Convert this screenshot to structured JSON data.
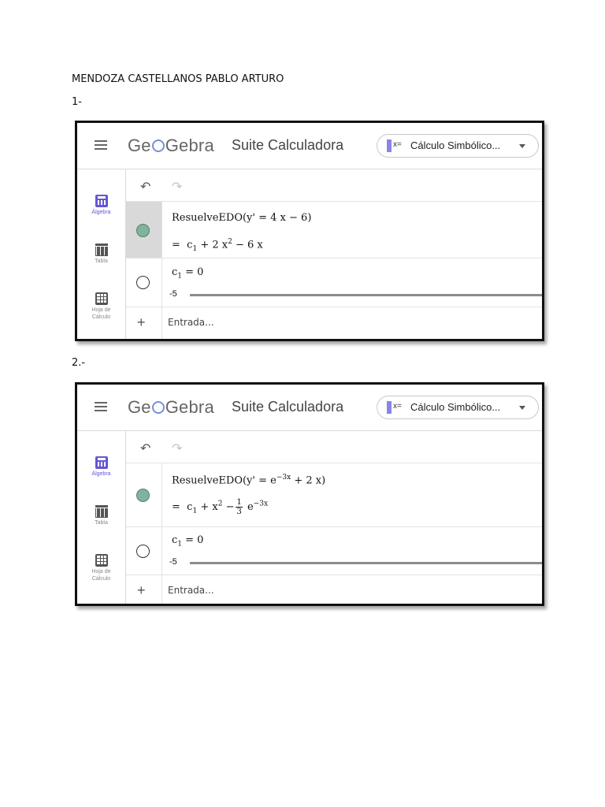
{
  "document": {
    "author": "MENDOZA CASTELLANOS PABLO ARTURO",
    "label_1": "1-",
    "label_2": "2.-"
  },
  "app": {
    "logo_part1": "Ge",
    "logo_part2": "Gebra",
    "suite_title": "Suite Calculadora",
    "selector_badge": "x=",
    "selector_value": "Cálculo Simbólico...",
    "sidebar": {
      "algebra": "Álgebra",
      "table": "Tabla",
      "sheet_line1": "Hoja de",
      "sheet_line2": "Cálculo"
    },
    "input_placeholder": "Entrada..."
  },
  "screens": [
    {
      "command_name": "ResuelveEDO",
      "command_args_prefix": "(y'",
      "command_eq": "= 4 x − 6)",
      "result_eq": "=",
      "result_a": "c",
      "result_a_sub": "1",
      "result_b": "+ 2 x",
      "result_b_sup": "2",
      "result_c": "− 6 x",
      "slider_var": "c",
      "slider_var_sub": "1",
      "slider_eq": "= 0",
      "slider_min": "-5"
    },
    {
      "command_name": "ResuelveEDO",
      "command_args_prefix": "(y'",
      "command_eq": "= e",
      "command_exp": "−3x",
      "command_tail": "+ 2 x)",
      "result_eq": "=",
      "result_a": "c",
      "result_a_sub": "1",
      "result_b": "+ x",
      "result_b_sup": "2",
      "result_c": "−",
      "frac_num": "1",
      "frac_den": "3",
      "result_d": "e",
      "result_d_sup": "−3x",
      "slider_var": "c",
      "slider_var_sub": "1",
      "slider_eq": "= 0",
      "slider_min": "-5"
    }
  ]
}
